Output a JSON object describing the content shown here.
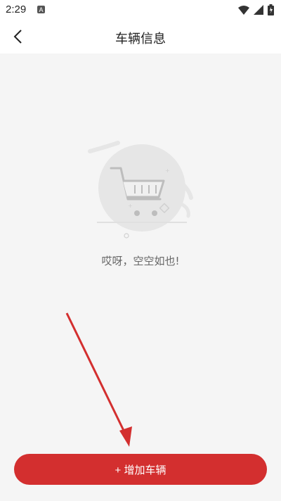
{
  "status_bar": {
    "time": "2:29"
  },
  "header": {
    "title": "车辆信息"
  },
  "empty_state": {
    "message": "哎呀，空空如也!"
  },
  "footer": {
    "add_button_label": "+ 增加车辆"
  },
  "colors": {
    "accent": "#d32f2f",
    "background": "#f5f5f5",
    "header_bg": "#ffffff"
  },
  "icons": {
    "back": "chevron-left-icon",
    "empty": "shopping-cart-icon",
    "wifi": "wifi-icon",
    "signal": "signal-icon",
    "battery": "battery-icon"
  }
}
